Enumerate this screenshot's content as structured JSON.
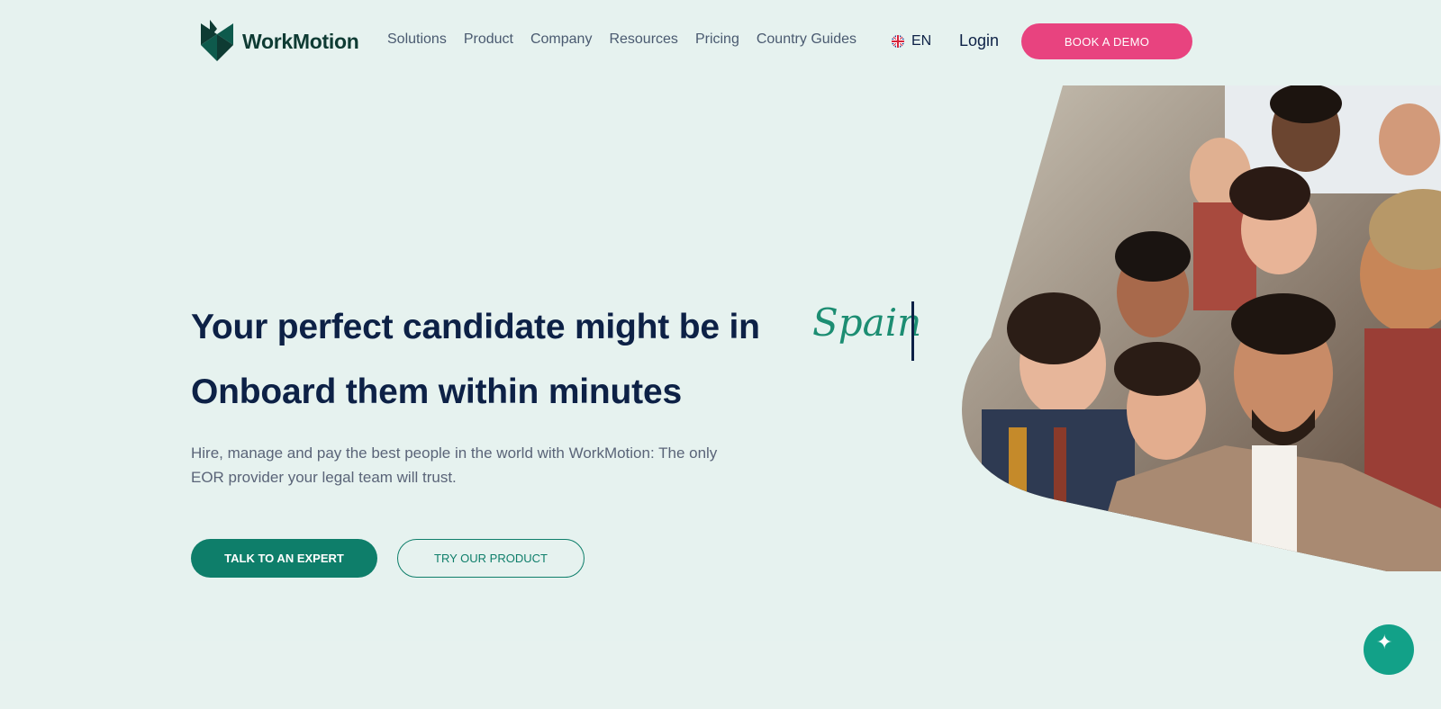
{
  "header": {
    "brand": "WorkMotion",
    "nav": [
      "Solutions",
      "Product",
      "Company",
      "Resources",
      "Pricing",
      "Country Guides"
    ],
    "language": "EN",
    "login": "Login",
    "cta": "BOOK A DEMO"
  },
  "hero": {
    "headline_prefix": "Your perfect candidate might be in",
    "country": "Spain",
    "headline_line2": "Onboard them within minutes",
    "subtext": "Hire, manage and pay the best people in the world with WorkMotion: The only EOR provider your legal team will trust.",
    "primary_cta": "TALK TO AN EXPERT",
    "secondary_cta": "TRY OUR PRODUCT"
  },
  "colors": {
    "background": "#e6f2ef",
    "navy": "#0d2146",
    "accent_pink": "#e8437f",
    "brand_green": "#0e7e6a",
    "script_green": "#1c8d72"
  },
  "icons": {
    "logo": "workmotion-logo-icon",
    "language_flag": "uk-flag-icon",
    "chat": "chat-sparkle-icon"
  }
}
